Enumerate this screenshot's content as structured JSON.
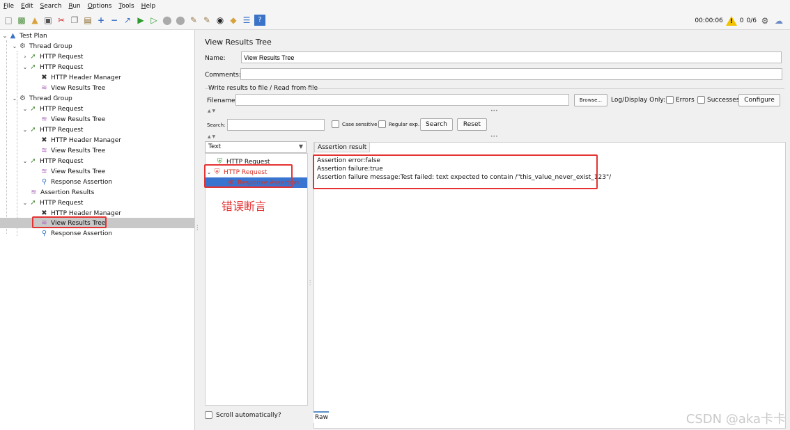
{
  "menu": [
    "File",
    "Edit",
    "Search",
    "Run",
    "Options",
    "Tools",
    "Help"
  ],
  "toolbar": {
    "icons": [
      "new-icon",
      "templates-icon",
      "open-icon",
      "save-icon",
      "cut-icon",
      "copy-icon",
      "paste-icon",
      "expand-icon",
      "collapse-icon",
      "toggle-icon",
      "start-icon",
      "start-no-pause-icon",
      "stop-icon",
      "shutdown-icon",
      "clear-icon",
      "clear-all-icon",
      "search-icon",
      "reset-search-icon",
      "function-helper-icon",
      "help-icon"
    ],
    "timer": "00:00:06",
    "warnings": "0",
    "threads": "0/6"
  },
  "tree": [
    {
      "label": "Test Plan",
      "icon": "test-plan-icon"
    },
    {
      "label": "Thread Group",
      "icon": "thread-group-icon"
    },
    {
      "label": "HTTP Request",
      "icon": "sampler-icon"
    },
    {
      "label": "HTTP Request",
      "icon": "sampler-icon"
    },
    {
      "label": "HTTP Header Manager",
      "icon": "config-icon"
    },
    {
      "label": "View Results Tree",
      "icon": "listener-icon"
    },
    {
      "label": "Thread Group",
      "icon": "thread-group-icon"
    },
    {
      "label": "HTTP Request",
      "icon": "sampler-icon"
    },
    {
      "label": "View Results Tree",
      "icon": "listener-icon"
    },
    {
      "label": "HTTP Request",
      "icon": "sampler-icon"
    },
    {
      "label": "HTTP Header Manager",
      "icon": "config-icon"
    },
    {
      "label": "View Results Tree",
      "icon": "listener-icon"
    },
    {
      "label": "HTTP Request",
      "icon": "sampler-icon"
    },
    {
      "label": "View Results Tree",
      "icon": "listener-icon"
    },
    {
      "label": "Response Assertion",
      "icon": "assertion-icon"
    },
    {
      "label": "Assertion Results",
      "icon": "listener-icon"
    },
    {
      "label": "HTTP Request",
      "icon": "sampler-icon"
    },
    {
      "label": "HTTP Header Manager",
      "icon": "config-icon"
    },
    {
      "label": "View Results Tree",
      "icon": "listener-icon"
    },
    {
      "label": "Response Assertion",
      "icon": "assertion-icon"
    }
  ],
  "panel": {
    "title": "View Results Tree",
    "name_label": "Name:",
    "name_value": "View Results Tree",
    "comments_label": "Comments:",
    "comments_value": "",
    "file_group": "Write results to file / Read from file",
    "filename_label": "Filename",
    "filename_value": "",
    "browse": "Browse...",
    "log_display": "Log/Display Only:",
    "errors": "Errors",
    "successes": "Successes",
    "configure": "Configure",
    "search_label": "Search:",
    "search_value": "",
    "case_sensitive": "Case sensitive",
    "regular_exp": "Regular exp.",
    "search_btn": "Search",
    "reset_btn": "Reset"
  },
  "results": {
    "renderer": "Text",
    "items": [
      {
        "label": "HTTP Request",
        "status": "success"
      },
      {
        "label": "HTTP Request",
        "status": "failure"
      },
      {
        "label": "Response Assertion",
        "status": "failure"
      }
    ],
    "scroll_auto": "Scroll automatically?",
    "tab": "Assertion result",
    "lines": [
      "Assertion error:false",
      "Assertion failure:true",
      "Assertion failure message:Test failed: text expected to contain /\"this_value_never_exist_123\"/"
    ],
    "raw_tab": "Raw"
  },
  "annotation": "错误断言",
  "watermark": "CSDN @aka卡卡",
  "colors": {
    "highlight": "#e53333",
    "selected": "#3874d0",
    "failure": "#d93025",
    "success": "#3a9d3a"
  }
}
